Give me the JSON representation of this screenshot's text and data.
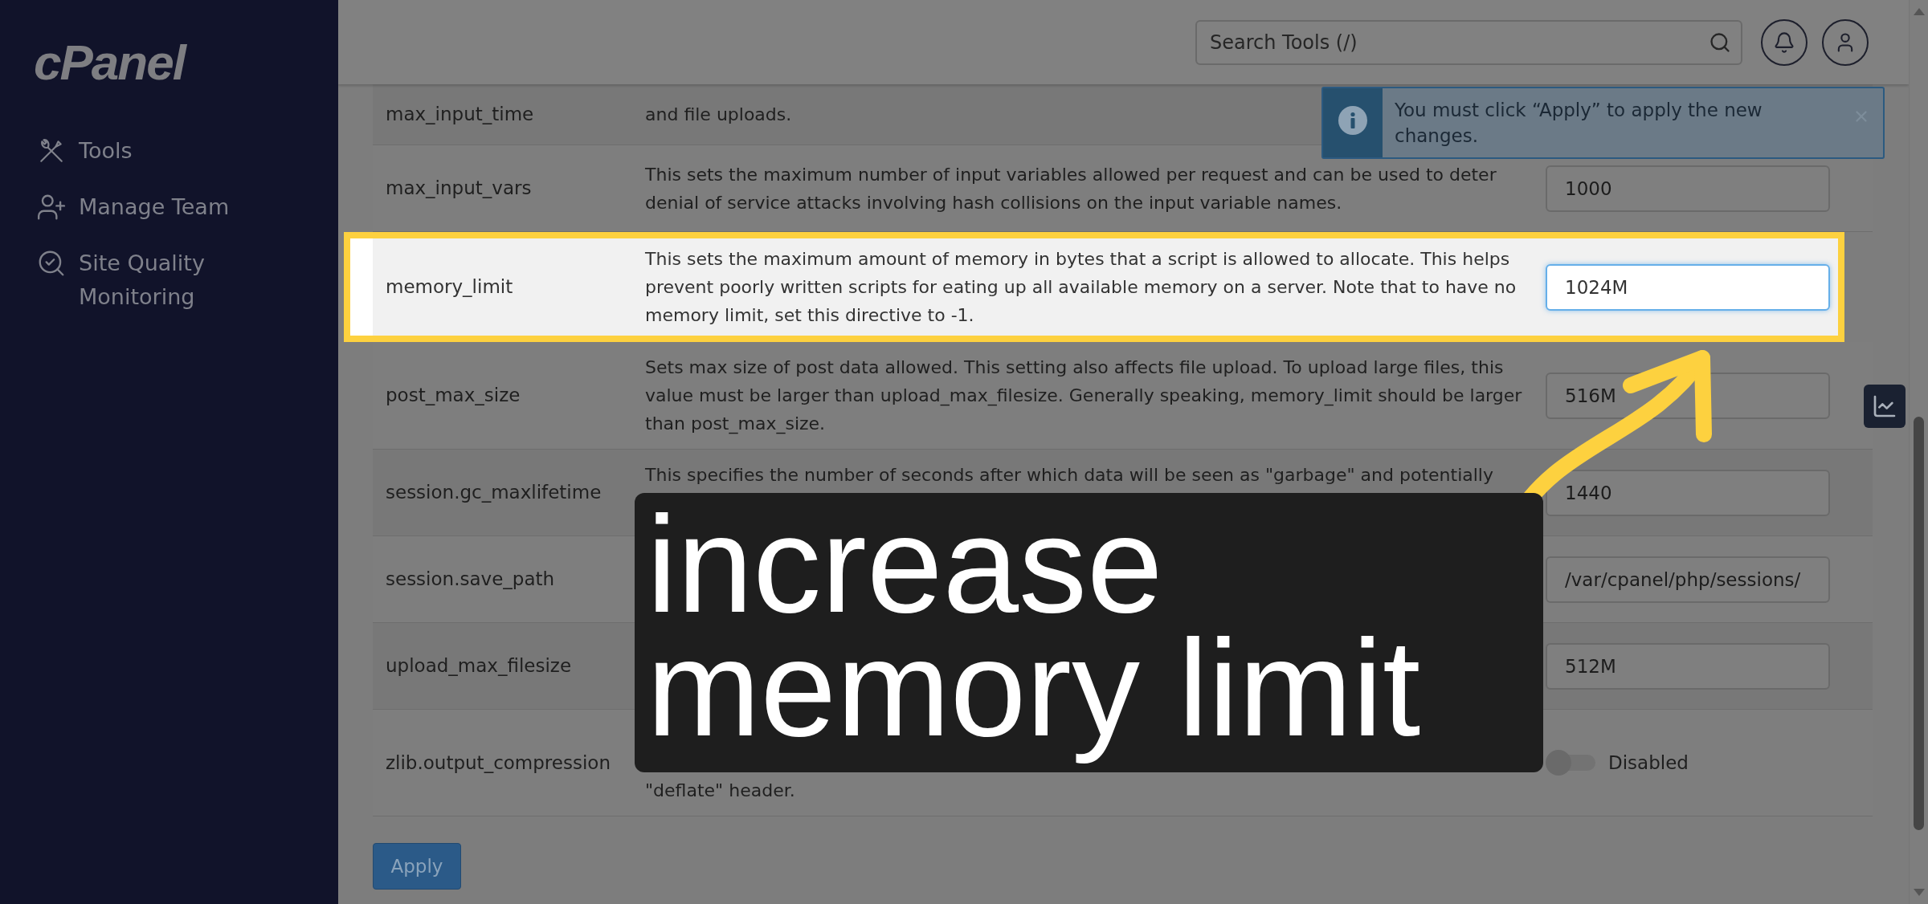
{
  "sidebar": {
    "logo": "cPanel",
    "items": [
      {
        "label": "Tools"
      },
      {
        "label": "Manage Team"
      },
      {
        "label": "Site Quality Monitoring"
      }
    ]
  },
  "search": {
    "placeholder": "Search Tools (/)"
  },
  "notice": {
    "text": "You must click “Apply” to apply the new changes."
  },
  "settings": [
    {
      "name": "max_input_time",
      "description": "and file uploads.",
      "highlighted": false
    },
    {
      "name": "max_input_vars",
      "description": "This sets the maximum number of input variables allowed per request and can be used to deter denial of service attacks involving hash collisions on the input variable names.",
      "highlighted": false,
      "kind": "text",
      "value": "1000",
      "focused": false
    },
    {
      "name": "memory_limit",
      "description": "This sets the maximum amount of memory in bytes that a script is allowed to allocate. This helps prevent poorly written scripts for eating up all available memory on a server. Note that to have no memory limit, set this directive to -1.",
      "highlighted": true,
      "kind": "text",
      "value": "1024M",
      "focused": true
    },
    {
      "name": "post_max_size",
      "description": "Sets max size of post data allowed. This setting also affects file upload. To upload large files, this value must be larger than upload_max_filesize. Generally speaking, memory_limit should be larger than post_max_size.",
      "highlighted": false,
      "kind": "text",
      "value": "516M",
      "focused": false
    },
    {
      "name": "session.gc_maxlifetime",
      "description": "This specifies the number of seconds after which data will be seen as \"garbage\" and potentially",
      "highlighted": false,
      "kind": "text",
      "value": "1440",
      "focused": false
    },
    {
      "name": "session.save_path",
      "highlighted": false,
      "kind": "text",
      "value": "/var/cpanel/php/sessions/",
      "focused": false
    },
    {
      "name": "upload_max_filesize",
      "highlighted": false,
      "kind": "text",
      "value": "512M",
      "focused": false
    },
    {
      "name": "zlib.output_compression",
      "description": "\"deflate\" header.",
      "highlighted": false,
      "kind": "toggle",
      "on": false,
      "label": "Disabled"
    }
  ],
  "apply_button": {
    "label": "Apply"
  },
  "caption": {
    "text": "increase memory limit"
  }
}
